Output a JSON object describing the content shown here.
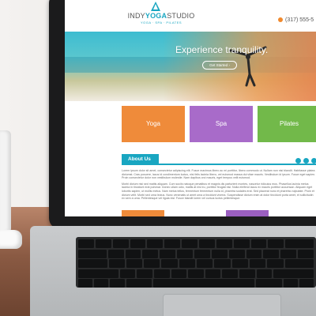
{
  "site": {
    "brand_prefix": "INDY",
    "brand_bold": "YOGA",
    "brand_suffix": "STUDIO",
    "tagline": "YOGA · SPA · PILATES",
    "phone": "(317) 555-5",
    "accent": "#19a6c1",
    "phone_icon": "phone-icon"
  },
  "hero": {
    "headline": "Experience tranquility.",
    "button": "Get Started"
  },
  "tiles": [
    {
      "label": "Yoga",
      "color": "#ef8b3a"
    },
    {
      "label": "Spa",
      "color": "#a86bc9"
    },
    {
      "label": "Pilates",
      "color": "#72b94a"
    }
  ],
  "about": {
    "heading": "About Us",
    "paragraphs": [
      "Lorem ipsum dolor sit amet, consectetur adipiscing elit. Fusce maximus libero ac mi porttitor, libero commodo ut. Nullam non nisi blandit. Habitasse platea dictumst. Cras posuere, lacus id condimentum luctus, nisi felis lacinia libero, vel euismod massa dui vitae mauris. Vestibulum id ipsum. Fusce eget sapien. Proin consectetur dolor non vestibulum molestie. Nam dapibus orci mauris, eget tempus velit euismod.",
      "Morbi dictum nisi sed mattis aliquam. Cum sociis natoque penatibus et magnis dis parturient montes, nascetur ridiculus mus. Phasellus lacinia metus lacinia in tincidunt erat pulvinar. Donec ullam odio, mattis at nisl eu, porttitor feugiat nisi. Nulla eleifend lacus ex mauris porttitor accumsan. Aliquam eget lobortis sapien, ut mollis metus. Nam metus tellus, fermentum fermentum nulla id, pharetra sodales erat. Sed placerat nunc et pharetra vulputate. Proin et dictum velit. Morbi sed urna lectus. Nunc venenatis ut amet urna a tincidunt viverra. Suspendisse dictum enim at dolor tincidunt porta amet, et sollicitudin ex sem a urna. Pellentesque vel ligula nisl. Fusce blandit lorem vel cursus luctus pellentesque."
    ]
  }
}
